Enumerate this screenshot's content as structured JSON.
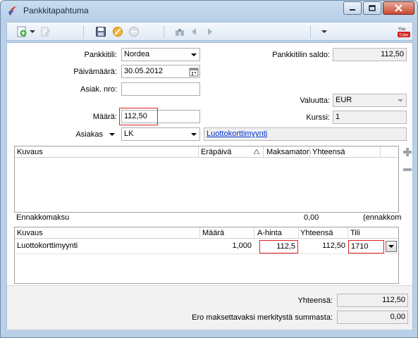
{
  "window": {
    "title": "Pankkitapahtuma"
  },
  "toolbar": {
    "youtube_label": "You Tube"
  },
  "form": {
    "pankkitili_label": "Pankkitili:",
    "pankkitili_value": "Nordea",
    "paivamaara_label": "Päivämäärä:",
    "paivamaara_value": "30.05.2012",
    "asiak_nro_label": "Asiak. nro:",
    "asiak_nro_value": "",
    "maara_label": "Määrä:",
    "maara_value": "112,50",
    "asiakas_label": "Asiakas",
    "asiakas_value": "LK",
    "saldo_label": "Pankkitilin saldo:",
    "saldo_value": "112,50",
    "valuutta_label": "Valuutta:",
    "valuutta_value": "EUR",
    "kurssi_label": "Kurssi:",
    "kurssi_value": "1",
    "link_text": "Luottokorttimyynti"
  },
  "invoice_grid": {
    "columns": [
      "Kuvaus",
      "Eräpäivä",
      "Maksamaton",
      "Yhteensä"
    ],
    "ennakko_label": "Ennakkomaksu",
    "ennakko_value": "0,00",
    "ennakko_note": "(ennakkom"
  },
  "rows_grid": {
    "columns": [
      "Kuvaus",
      "Määrä",
      "A-hinta",
      "Yhteensä",
      "Tili"
    ],
    "rows": [
      {
        "kuvaus": "Luottokorttimyynti",
        "maara": "1,000",
        "ahinta": "112,5",
        "yhteensa": "112,50",
        "tili": "1710"
      }
    ]
  },
  "footer": {
    "yhteensa_label": "Yhteensä:",
    "yhteensa_value": "112,50",
    "ero_label": "Ero maksettavaksi merkitystä summasta:",
    "ero_value": "0,00"
  },
  "colors": {
    "highlight": "#e02020",
    "link": "#0033cc"
  }
}
